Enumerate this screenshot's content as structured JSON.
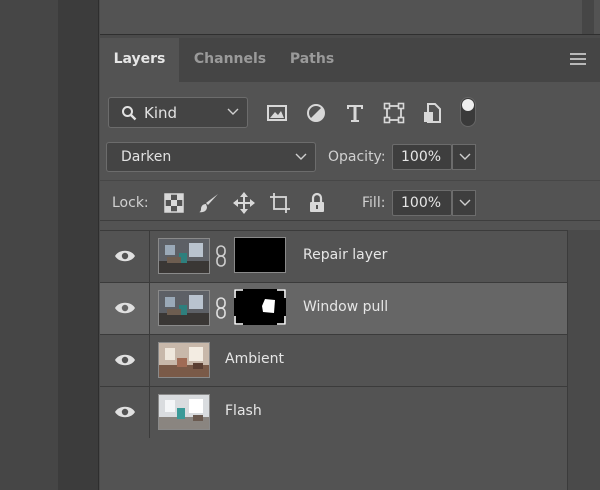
{
  "tabs": [
    {
      "label": "Layers",
      "active": true
    },
    {
      "label": "Channels",
      "active": false
    },
    {
      "label": "Paths",
      "active": false
    }
  ],
  "filter": {
    "kind_label": "Kind",
    "icons": [
      "search-icon",
      "image-filter-icon",
      "adjustment-filter-icon",
      "type-filter-icon",
      "shape-filter-icon",
      "smart-object-filter-icon"
    ]
  },
  "blend": {
    "mode": "Darken",
    "opacity_label": "Opacity:",
    "opacity_value": "100%"
  },
  "lock": {
    "label": "Lock:",
    "icons": [
      "lock-transparent-icon",
      "lock-image-icon",
      "lock-position-icon",
      "lock-artboard-icon",
      "lock-all-icon"
    ],
    "fill_label": "Fill:",
    "fill_value": "100%"
  },
  "layers": [
    {
      "name": "Repair layer",
      "visible": true,
      "selected": false,
      "has_mask": true
    },
    {
      "name": "Window pull",
      "visible": true,
      "selected": true,
      "has_mask": true
    },
    {
      "name": "Ambient",
      "visible": true,
      "selected": false,
      "has_mask": false
    },
    {
      "name": "Flash",
      "visible": true,
      "selected": false,
      "has_mask": false
    }
  ],
  "colors": {
    "panel_bg": "#535353",
    "selected_row": "#666666",
    "text": "#e6e6e6"
  }
}
